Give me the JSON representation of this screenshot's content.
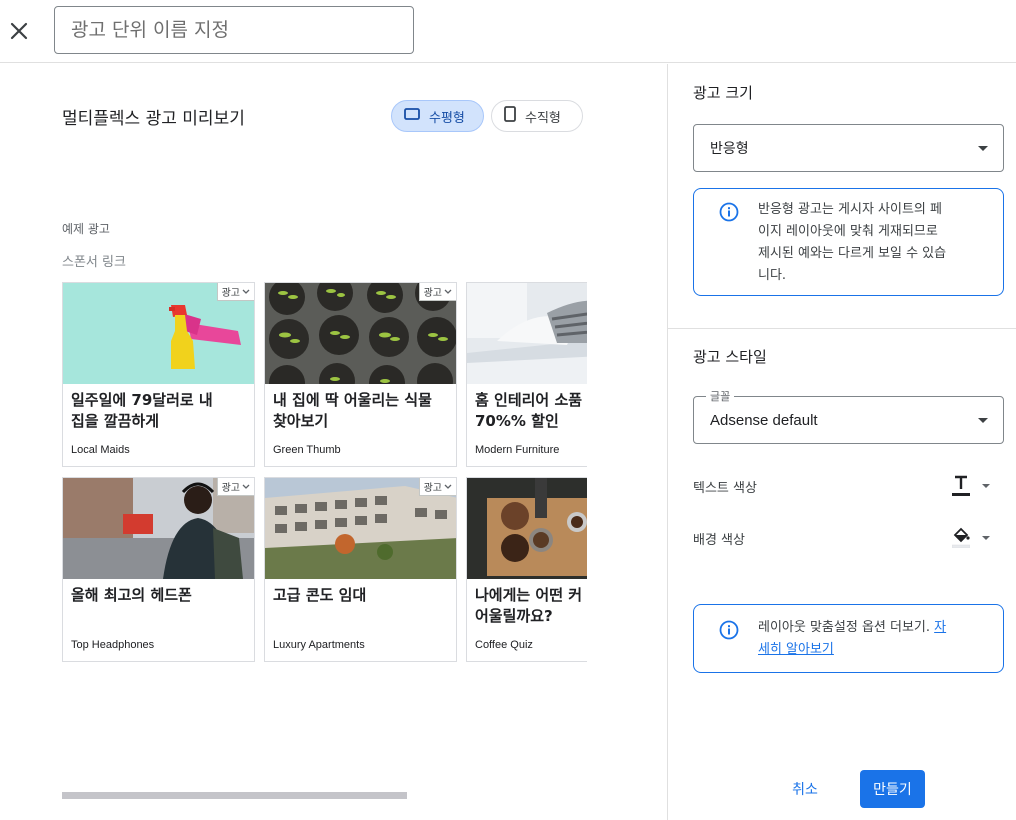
{
  "header": {
    "name_placeholder": "광고 단위 이름 지정",
    "name_value": ""
  },
  "preview": {
    "title": "멀티플렉스 광고 미리보기",
    "orientation_horizontal": "수평형",
    "orientation_vertical": "수직형",
    "selected_orientation": "수평형",
    "sample_label": "예제 광고",
    "sponsored_label": "스폰서 링크",
    "ad_badge": "광고",
    "cards": [
      {
        "headline": "일주일에 79달러로 내\n집을 깔끔하게",
        "advertiser": "Local Maids",
        "image": "spray-bottle"
      },
      {
        "headline": "내 집에 딱 어울리는 식물\n찾아보기",
        "advertiser": "Green Thumb",
        "image": "seedlings"
      },
      {
        "headline": "홈 인테리어 소품\n70%% 할인",
        "advertiser": "Modern Furniture",
        "image": "bedroom"
      },
      {
        "headline": "올해 최고의 헤드폰",
        "advertiser": "Top Headphones",
        "image": "street-headphones"
      },
      {
        "headline": "고급 콘도 임대",
        "advertiser": "Luxury Apartments",
        "image": "apartment-building"
      },
      {
        "headline": "나에게는 어떤 커\n어울릴까요?",
        "advertiser": "Coffee Quiz",
        "image": "coffee-beans"
      }
    ]
  },
  "panel": {
    "size_title": "광고 크기",
    "size_value": "반응형",
    "size_info": "반응형 광고는 게시자 사이트의 페\n이지 레이아웃에 맞춰 게재되므로\n제시된 예와는 다르게 보일 수 있습\n니다.",
    "style_title": "광고 스타일",
    "font_label": "글꼴",
    "font_value": "Adsense default",
    "text_color_label": "텍스트 색상",
    "bg_color_label": "배경 색상",
    "layout_info": "레이아웃 맞춤설정 옵션 더보기. ",
    "layout_link_line1": "자",
    "layout_link_line2": "세히 알아보기",
    "cancel": "취소",
    "create": "만들기"
  },
  "colors": {
    "accent": "#1a73e8",
    "selected_chip_bg": "#d2e3fc"
  },
  "icons": {
    "close": "close-icon",
    "horizontal": "horizontal-layout-icon",
    "vertical": "vertical-layout-icon",
    "info": "info-icon",
    "text_color": "text-color-icon",
    "fill_color": "fill-color-icon",
    "chevron": "chevron-down-icon"
  }
}
